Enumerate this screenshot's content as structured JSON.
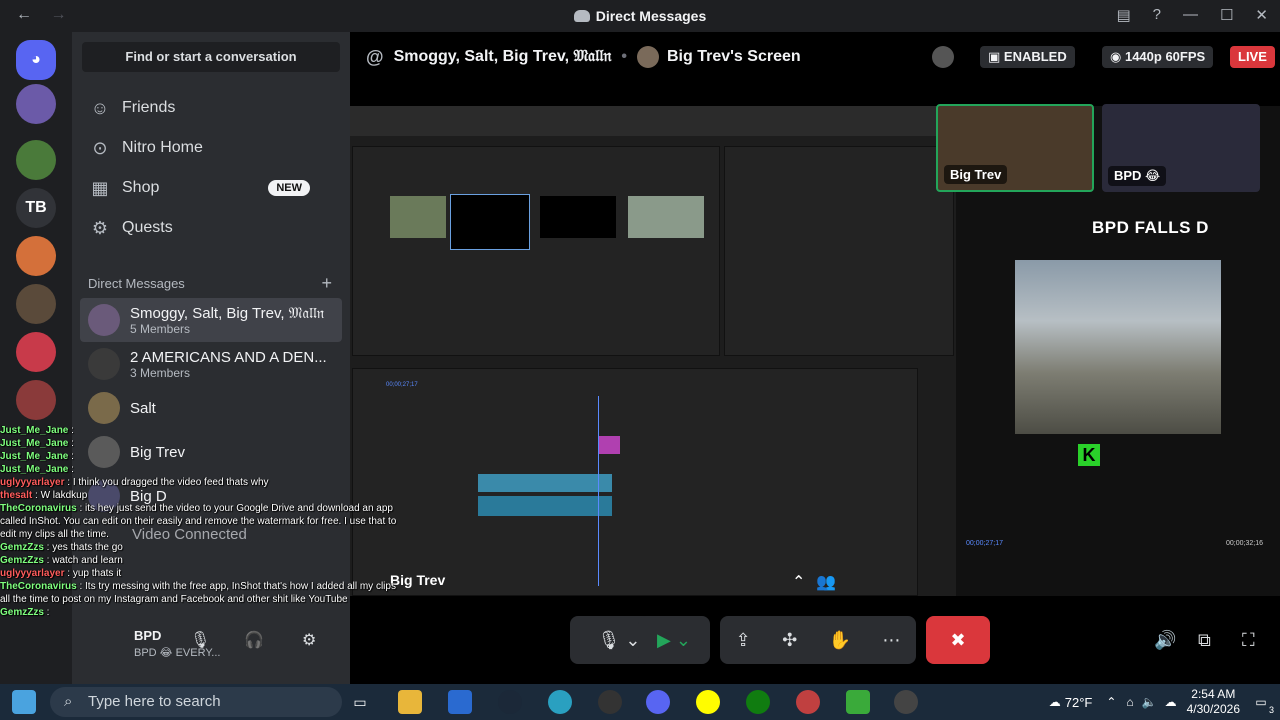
{
  "window": {
    "title": "Direct Messages",
    "back": "←",
    "forward": "→"
  },
  "titlebar_icons": [
    "inbox-icon",
    "help-icon",
    "minimize-icon",
    "maximize-icon",
    "close-icon"
  ],
  "servers": [
    {
      "name": "discord-home",
      "label": ""
    },
    {
      "name": "server-avatar-1",
      "label": ""
    },
    {
      "name": "server-avatar-2",
      "label": ""
    },
    {
      "name": "server-tb",
      "label": "TB"
    },
    {
      "name": "server-avatar-3",
      "label": ""
    },
    {
      "name": "server-avatar-4",
      "label": ""
    },
    {
      "name": "server-avatar-5",
      "label": ""
    },
    {
      "name": "server-avatar-6",
      "label": ""
    }
  ],
  "sidebar": {
    "find": "Find or start a conversation",
    "nav": [
      {
        "label": "Friends",
        "icon": "friends-icon"
      },
      {
        "label": "Nitro Home",
        "icon": "nitro-icon"
      },
      {
        "label": "Shop",
        "icon": "shop-icon",
        "badge": "NEW"
      },
      {
        "label": "Quests",
        "icon": "quests-icon"
      }
    ],
    "dm_header": "Direct Messages",
    "dms": [
      {
        "name": "Smoggy, Salt, Big Trev, 𝔐𝔞𝔩𝔩𝔫",
        "sub": "5 Members"
      },
      {
        "name": "2 AMERICANS AND A DEN...",
        "sub": "3 Members"
      },
      {
        "name": "Salt",
        "sub": ""
      },
      {
        "name": "Big Trev",
        "sub": ""
      },
      {
        "name": "Big D",
        "sub": ""
      }
    ],
    "voice_status": "Video Connected",
    "user_name": "BPD",
    "user_status": "BPD 😂 EVERY..."
  },
  "header": {
    "channel": "Smoggy, Salt, Big Trev, 𝔐𝔞𝔩𝔩𝔫",
    "screen": "Big Trev's Screen",
    "enabled": "ENABLED",
    "quality": "1440p 60FPS",
    "live": "LIVE"
  },
  "stream": {
    "video_title": "BPD FALLS D",
    "cam1": "Big Trev",
    "cam2": "BPD 😂",
    "timecode_left": "00;00;27;17",
    "timecode_right": "00;00;32;16",
    "fit": "Fit",
    "full": "Full",
    "streamer_label": "Big Trev"
  },
  "chat": [
    {
      "user": "Just_Me_Jane",
      "color": "#7fff7f",
      "text": " :"
    },
    {
      "user": "Just_Me_Jane",
      "color": "#7fff7f",
      "text": " :"
    },
    {
      "user": "Just_Me_Jane",
      "color": "#7fff7f",
      "text": " :"
    },
    {
      "user": "Just_Me_Jane",
      "color": "#7fff7f",
      "text": " :"
    },
    {
      "user": "uglyyyarlayer",
      "color": "#ff5c5c",
      "text": " : I think you dragged the video feed thats why"
    },
    {
      "user": "thesalt",
      "color": "#ff5c5c",
      "text": " : W lakdkup"
    },
    {
      "user": "TheCoronavirus",
      "color": "#7fff7f",
      "text": " : its hey just send the video to your Google Drive and download an app called InShot. You can edit on their easily and remove the watermark for free. I use that to edit my clips all the time."
    },
    {
      "user": "GemzZzs",
      "color": "#7fff7f",
      "text": " : yes thats the go"
    },
    {
      "user": "GemzZzs",
      "color": "#7fff7f",
      "text": " : watch and learn"
    },
    {
      "user": "uglyyyarlayer",
      "color": "#ff5c5c",
      "text": " : yup thats it"
    },
    {
      "user": "TheCoronavirus",
      "color": "#7fff7f",
      "text": " : Its try messing with the free app, InShot that's how I added all my clips all the time to post on my Instagram and Facebook and other shit like YouTube"
    },
    {
      "user": "GemzZzs",
      "color": "#7fff7f",
      "text": " :"
    }
  ],
  "taskbar": {
    "search": "Type here to search",
    "weather": "72°F",
    "time": "2:54 AM",
    "date": "4/30/2026",
    "notifications": "3"
  }
}
